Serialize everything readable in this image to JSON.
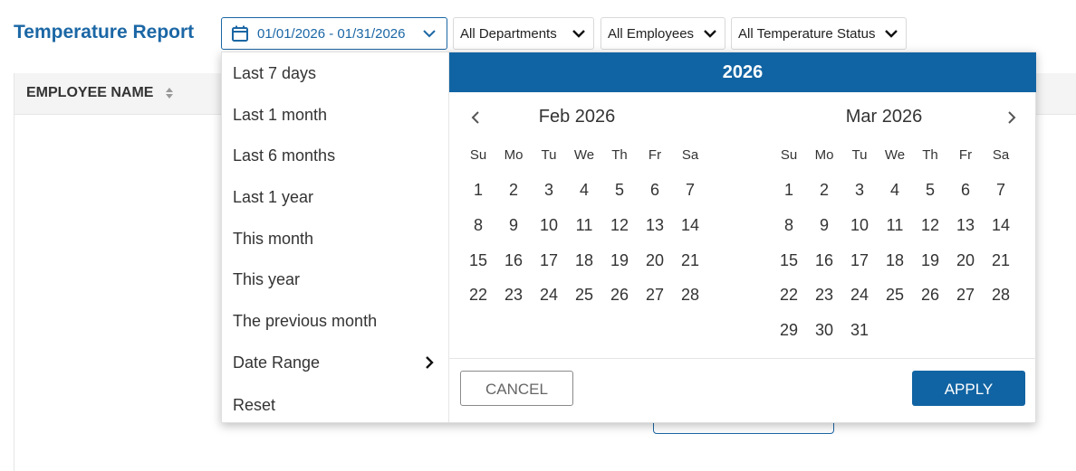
{
  "page": {
    "title": "Temperature Report"
  },
  "filters": {
    "date_range": "01/01/2026 - 01/31/2026",
    "departments": "All Departments",
    "employees": "All Employees",
    "temperature_status": "All Temperature Status"
  },
  "table": {
    "columns": [
      "EMPLOYEE NAME"
    ]
  },
  "presets": [
    "Last 7 days",
    "Last 1 month",
    "Last 6 months",
    "Last 1 year",
    "This month",
    "This year",
    "The previous month",
    "Date Range",
    "Reset"
  ],
  "calendar": {
    "year": "2026",
    "weekdays": [
      "Su",
      "Mo",
      "Tu",
      "We",
      "Th",
      "Fr",
      "Sa"
    ],
    "months": [
      {
        "title": "Feb 2026",
        "start_weekday": 0,
        "days": 28
      },
      {
        "title": "Mar 2026",
        "start_weekday": 0,
        "days": 31
      }
    ]
  },
  "actions": {
    "cancel": "CANCEL",
    "apply": "APPLY"
  },
  "colors": {
    "accent": "#1164a3",
    "title": "#1b67a5"
  },
  "icons": {
    "date": "calendar-icon",
    "dropdown": "chevron-down-icon",
    "sort": "sort-icon",
    "prev": "chevron-left-icon",
    "next": "chevron-right-icon"
  }
}
